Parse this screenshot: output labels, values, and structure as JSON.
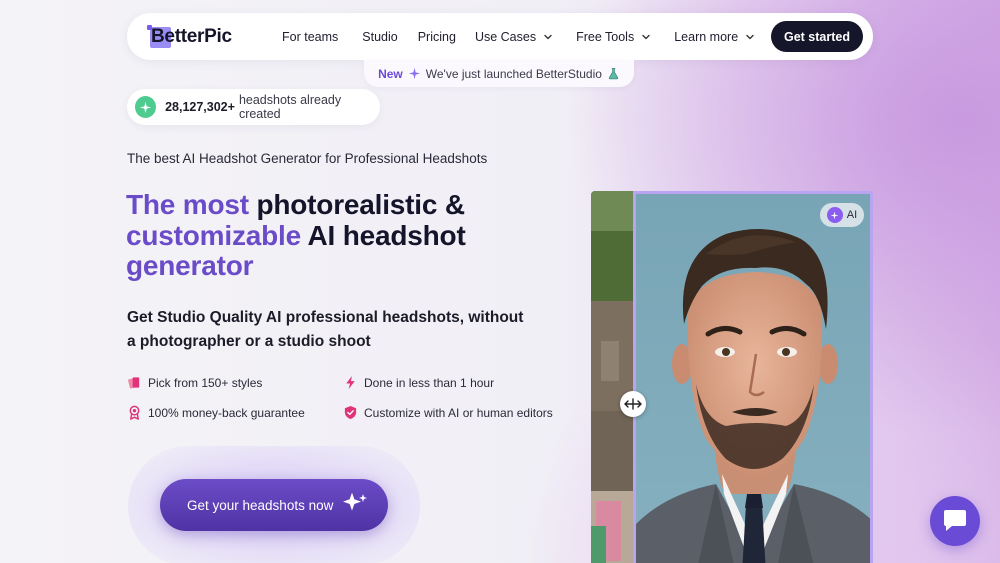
{
  "nav": {
    "logo": "BetterPic",
    "links": [
      {
        "label": "For teams",
        "has_dropdown": false
      },
      {
        "label": "Studio",
        "has_dropdown": false
      },
      {
        "label": "Pricing",
        "has_dropdown": false
      },
      {
        "label": "Use Cases",
        "has_dropdown": true
      },
      {
        "label": "Free Tools",
        "has_dropdown": true
      },
      {
        "label": "Learn more",
        "has_dropdown": true
      }
    ],
    "cta": "Get started"
  },
  "announcement": {
    "badge": "New",
    "text": "We've just launched BetterStudio",
    "icon": "sparkle-icon",
    "trailing_icon": "flask-icon"
  },
  "counter": {
    "number": "28,127,302+",
    "text": "headshots already created",
    "icon": "sparkle-icon",
    "icon_color": "#4ecb8f"
  },
  "hero": {
    "tagline": "The best AI Headshot Generator for Professional Headshots",
    "headline": {
      "purple_1": "The most",
      "dark_1": "photorealistic &",
      "purple_2": "customizable",
      "dark_2": "AI headshot",
      "purple_3": "generator"
    },
    "subheadline": "Get Studio Quality AI professional headshots, without a photographer or a studio shoot",
    "features": [
      {
        "icon": "styles-icon",
        "label": "Pick from 150+ styles"
      },
      {
        "icon": "lightning-icon",
        "label": "Done in less than 1 hour"
      },
      {
        "icon": "award-icon",
        "label": "100% money-back guarantee"
      },
      {
        "icon": "shield-check-icon",
        "label": "Customize with AI or human editors"
      }
    ],
    "cta": "Get your headshots now"
  },
  "compare": {
    "badge": "AI",
    "handle_icon": "arrows-horizontal-icon"
  },
  "colors": {
    "brand_purple": "#6a4bc8",
    "dark": "#15162a",
    "accent_pink": "#e0337a"
  }
}
